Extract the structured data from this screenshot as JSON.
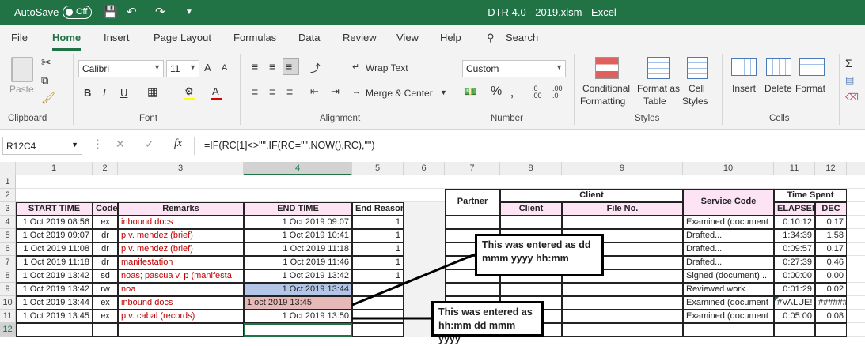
{
  "window": {
    "autosave_label": "AutoSave",
    "autosave_state": "Off",
    "title": "-- DTR 4.0 - 2019.xlsm  -  Excel"
  },
  "tabs": [
    "File",
    "Home",
    "Insert",
    "Page Layout",
    "Formulas",
    "Data",
    "Review",
    "View",
    "Help"
  ],
  "search_label": "Search",
  "ribbon": {
    "clipboard": {
      "paste": "Paste",
      "label": "Clipboard"
    },
    "font": {
      "name": "Calibri",
      "size": "11",
      "label": "Font",
      "bold": "B",
      "italic": "I",
      "underline": "U",
      "grow": "A",
      "shrink": "A"
    },
    "alignment": {
      "wrap": "Wrap Text",
      "merge": "Merge & Center",
      "label": "Alignment"
    },
    "number": {
      "format": "Custom",
      "label": "Number"
    },
    "styles": {
      "conditional": "Conditional",
      "formatting": "Formatting",
      "format_as": "Format as",
      "table": "Table",
      "cell": "Cell",
      "styles": "Styles",
      "label": "Styles"
    },
    "cells": {
      "insert": "Insert",
      "delete": "Delete",
      "format": "Format",
      "label": "Cells"
    }
  },
  "formula_bar": {
    "name_box": "R12C4",
    "formula": "=IF(RC[1]<>\"\",IF(RC=\"\",NOW(),RC),\"\")",
    "fx": "fx"
  },
  "columns": [
    "1",
    "2",
    "3",
    "4",
    "5",
    "6",
    "7",
    "8",
    "9",
    "10",
    "11",
    "12"
  ],
  "rows": [
    "1",
    "2",
    "3",
    "4",
    "5",
    "6",
    "7",
    "8",
    "9",
    "10",
    "11",
    "12"
  ],
  "left_table": {
    "headers": [
      "START TIME",
      "Code",
      "Remarks",
      "END TIME",
      "End Reason"
    ],
    "rows": [
      [
        "1 Oct 2019 08:56",
        "ex",
        "inbound docs",
        "1 Oct 2019 09:07",
        "1"
      ],
      [
        "1 Oct 2019 09:07",
        "dr",
        "p v. mendez (brief)",
        "1 Oct 2019 10:41",
        "1"
      ],
      [
        "1 Oct 2019 11:08",
        "dr",
        "p v. mendez (brief)",
        "1 Oct 2019 11:18",
        "1"
      ],
      [
        "1 Oct 2019 11:18",
        "dr",
        "manifestation",
        "1 Oct 2019 11:46",
        "1"
      ],
      [
        "1 Oct 2019 13:42",
        "sd",
        "noas; pascua v. p (manifesta",
        "1 Oct 2019 13:42",
        "1"
      ],
      [
        "1 Oct 2019 13:42",
        "rw",
        "noa",
        "1 Oct 2019 13:44",
        ""
      ],
      [
        "1 Oct 2019 13:44",
        "ex",
        "inbound docs",
        "1 oct 2019 13:45",
        ""
      ],
      [
        "1 Oct 2019 13:45",
        "ex",
        "p v. cabal (records)",
        "1 Oct 2019 13:50",
        ""
      ]
    ]
  },
  "right_table": {
    "partner": "Partner",
    "client_group": "Client",
    "client": "Client",
    "file_no": "File No.",
    "service_code": "Service Code",
    "time_spent": "Time Spent",
    "elapsed": "ELAPSED",
    "dec": "DEC",
    "rows": [
      [
        "Examined (document",
        "0:10:12",
        "0.17"
      ],
      [
        "Drafted...",
        "1:34:39",
        "1.58"
      ],
      [
        "Drafted...",
        "0:09:57",
        "0.17"
      ],
      [
        "Drafted...",
        "0:27:39",
        "0.46"
      ],
      [
        "Signed (document)...",
        "0:00:00",
        "0.00"
      ],
      [
        "Reviewed work",
        "0:01:29",
        "0.02"
      ],
      [
        "Examined (document",
        "#VALUE!",
        "######"
      ],
      [
        "Examined (document",
        "0:05:00",
        "0.08"
      ]
    ]
  },
  "callouts": {
    "first": "This was entered as dd mmm yyyy hh:mm",
    "second": "This was entered as hh:mm dd mmm yyyy"
  },
  "colors": {
    "excel_green": "#217346",
    "header_pink": "#fce4f4",
    "blue_cell": "#b4c6e7",
    "pink_cell": "#e6b8b7"
  }
}
